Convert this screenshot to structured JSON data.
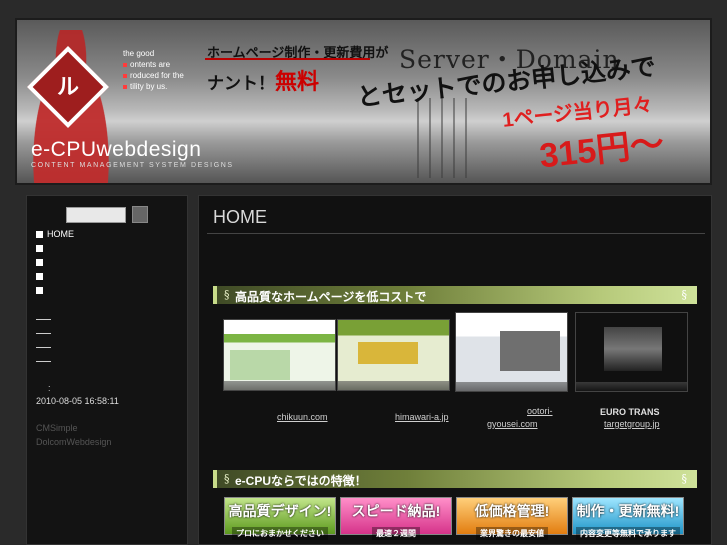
{
  "banner": {
    "logo_mark": "ル",
    "tagline": [
      "the good",
      "ontents are",
      "roduced for the",
      "tility by us."
    ],
    "brand": "e-CPUwebdesign",
    "brand_sub": "CONTENT MANAGEMENT SYSTEM DESIGNS",
    "promo_line1": "ホームページ制作・更新費用が",
    "promo_line2_a": "ナント！",
    "promo_line2_b": "無料",
    "server_domain": "Server・Domain",
    "set_line": "とセットでのお申し込みで",
    "price_line1": "1ページ当り月々",
    "price_line2": "315円～"
  },
  "sidebar": {
    "nav_home": "HOME",
    "timestamp": "2010-08-05 16:58:11",
    "credits": [
      "CMSimple",
      "DolcomWebdesign"
    ]
  },
  "main": {
    "page_title": "HOME",
    "section1": "高品質なホームページを低コストで",
    "section_mark": "§",
    "section2": "e-CPUならではの特徴！",
    "sites": [
      {
        "label": "chikuun.com"
      },
      {
        "label": "himawari-a.jp"
      },
      {
        "label_a": "ootori-",
        "label_b": "gyousei.com"
      },
      {
        "title": "EURO TRANS",
        "label": "targetgroup.jp"
      }
    ],
    "features": [
      {
        "big": "高品質デザイン!",
        "small": "プロにおまかせください"
      },
      {
        "big": "スピード納品!",
        "small": "最速２週間"
      },
      {
        "big": "低価格管理!",
        "small": "業界驚きの最安値"
      },
      {
        "big": "制作・更新無料!",
        "small": "内容変更等無料で承ります"
      }
    ]
  },
  "colors": {
    "accent_green": "#b6c97a",
    "banner_red": "#e01f1f"
  }
}
